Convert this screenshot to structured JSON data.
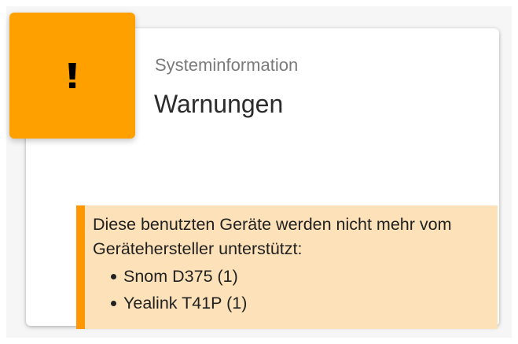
{
  "colors": {
    "icon_background": "#fea000",
    "notice_background": "#fde1b8",
    "notice_border": "#ff9800"
  },
  "card": {
    "icon": "warning-exclamation-icon",
    "subtitle": "Systeminformation",
    "title": "Warnungen"
  },
  "notice": {
    "text": "Diese benutzten Geräte werden nicht mehr vom Gerätehersteller unterstützt:",
    "items": [
      "Snom D375 (1)",
      "Yealink T41P (1)"
    ]
  }
}
